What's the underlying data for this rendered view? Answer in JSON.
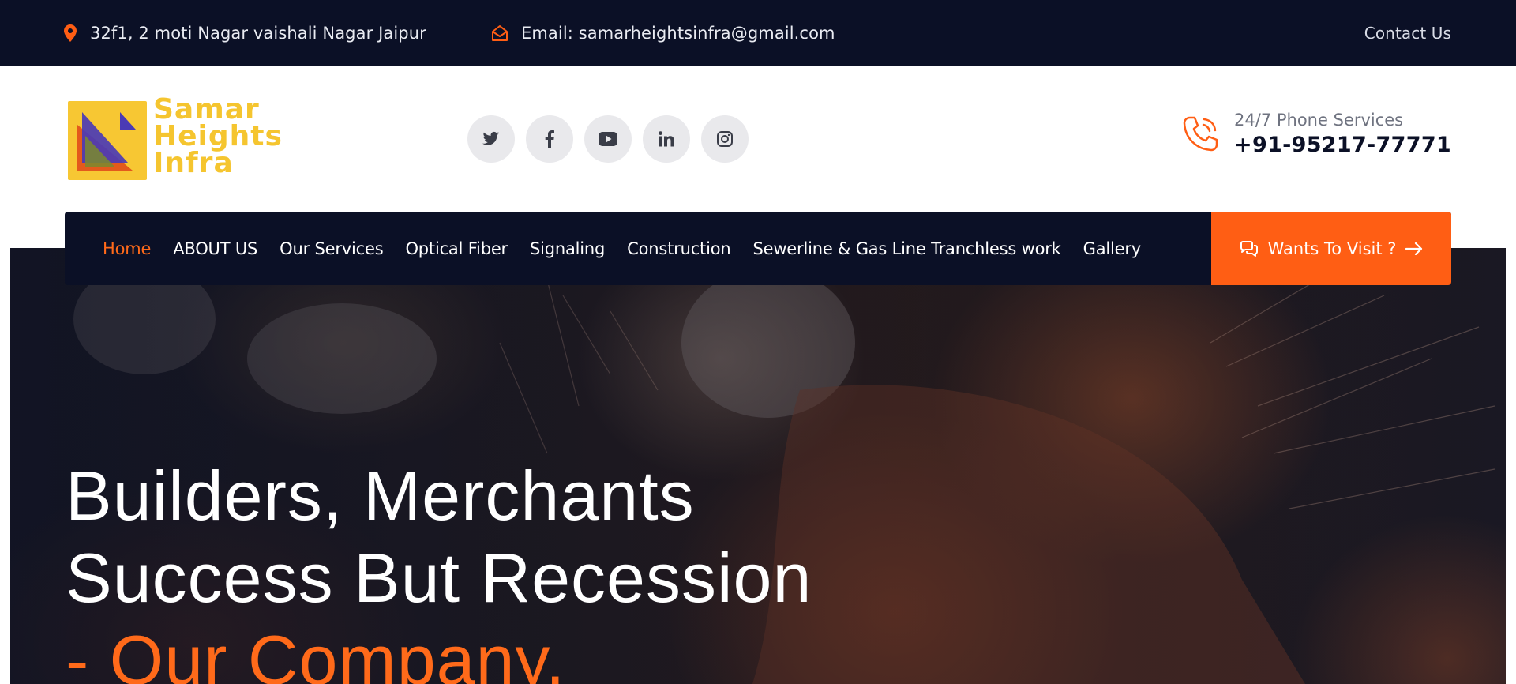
{
  "topbar": {
    "address": "32f1, 2 moti Nagar vaishali Nagar Jaipur",
    "address_icon": "map-pin-icon",
    "email": "Email: samarheightsinfra@gmail.com",
    "email_icon": "envelope-open-icon",
    "contact": "Contact Us"
  },
  "logo": {
    "line1": "Samar",
    "line2": "Heights",
    "line3": "Infra"
  },
  "social": [
    "twitter-icon",
    "facebook-icon",
    "youtube-icon",
    "linkedin-icon",
    "instagram-icon"
  ],
  "phone": {
    "label": "24/7 Phone Services",
    "number": "+91-95217-77771",
    "icon": "phone-icon"
  },
  "nav": {
    "items": [
      "Home",
      "ABOUT US",
      "Our Services",
      "Optical Fiber",
      "Signaling",
      "Construction",
      "Sewerline & Gas Line Tranchless work",
      "Gallery"
    ],
    "active": "Home",
    "cta": "Wants To Visit ?"
  },
  "hero": {
    "line1": "Builders, Merchants",
    "line2": "Success But Recession",
    "line3": "- Our Company."
  },
  "colors": {
    "navy": "#0b1026",
    "accent": "#ff5e14",
    "logo_yellow": "#f5c52f"
  }
}
